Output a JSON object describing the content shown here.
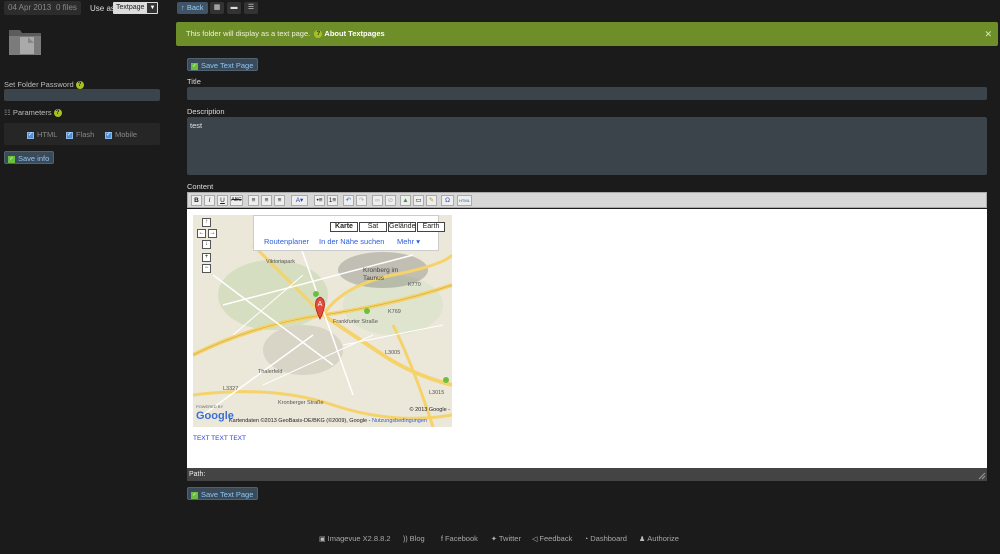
{
  "sidebar": {
    "date": "04 Apr 2013",
    "files": "0 files",
    "use_as_label": "Use as",
    "use_as_value": "Textpage",
    "password_label": "Set Folder Password",
    "parameters_label": "Parameters",
    "params": [
      {
        "label": "HTML",
        "checked": true
      },
      {
        "label": "Flash",
        "checked": true
      },
      {
        "label": "Mobile",
        "checked": true
      }
    ],
    "save_info": "Save info"
  },
  "toolbar": {
    "back": "Back"
  },
  "banner": {
    "text": "This folder will display as a text page.",
    "link": "About Textpages"
  },
  "editor": {
    "save_top": "Save Text Page",
    "title_label": "Title",
    "title_value": "",
    "description_label": "Description",
    "description_value": "test",
    "content_label": "Content",
    "path_label": "Path:",
    "save_bottom": "Save Text Page",
    "content_link": "TEXT TEXT TEXT"
  },
  "map": {
    "tabs": [
      "Karte",
      "Sat",
      "Gelände",
      "Earth"
    ],
    "active_tab": "Karte",
    "links": [
      "Routenplaner",
      "In der Nähe suchen",
      "Mehr"
    ],
    "labels": [
      "Viktoriapark",
      "Kronberg im Taunus",
      "Thalerfeld",
      "K770",
      "K769",
      "L3005",
      "L3015",
      "L3327",
      "Frankfurter Straße",
      "Kronberger Straße"
    ],
    "copyright": "© 2013 Google -",
    "attribution": "Kartendaten ©2013 GeoBasis-DE/BKG (©2009), Google -",
    "terms": "Nutzungsbedingungen",
    "logo": "Google",
    "powered": "POWERED BY"
  },
  "footer": {
    "items": [
      "Imagevue X2.8.8.2",
      "Blog",
      "Facebook",
      "Twitter",
      "Feedback",
      "Dashboard",
      "Authorize"
    ]
  },
  "colors": {
    "banner": "#6e8e2a",
    "field": "#3b434b",
    "background": "#1b1b1b"
  }
}
